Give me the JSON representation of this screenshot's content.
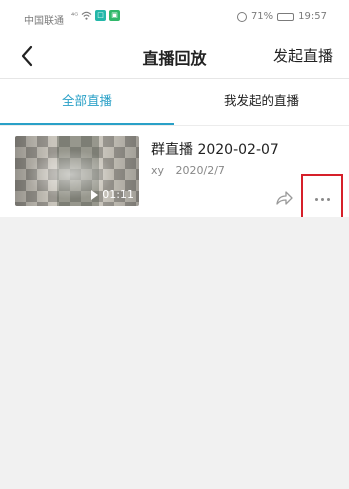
{
  "status_bar": {
    "carrier": "中国联通",
    "signal": "⁴ᴳ",
    "battery": "71%",
    "battery_level": 0.71,
    "time": "19:57"
  },
  "nav": {
    "title": "直播回放",
    "action": "发起直播"
  },
  "tabs": [
    {
      "label": "全部直播",
      "active": true
    },
    {
      "label": "我发起的直播",
      "active": false
    }
  ],
  "items": [
    {
      "title": "群直播 2020-02-07",
      "author": "xy",
      "date": "2020/2/7",
      "duration": "01:11"
    }
  ],
  "colors": {
    "accent": "#29a0c7",
    "highlight_box": "#d6202a",
    "page_bg": "#f1f1f1"
  }
}
